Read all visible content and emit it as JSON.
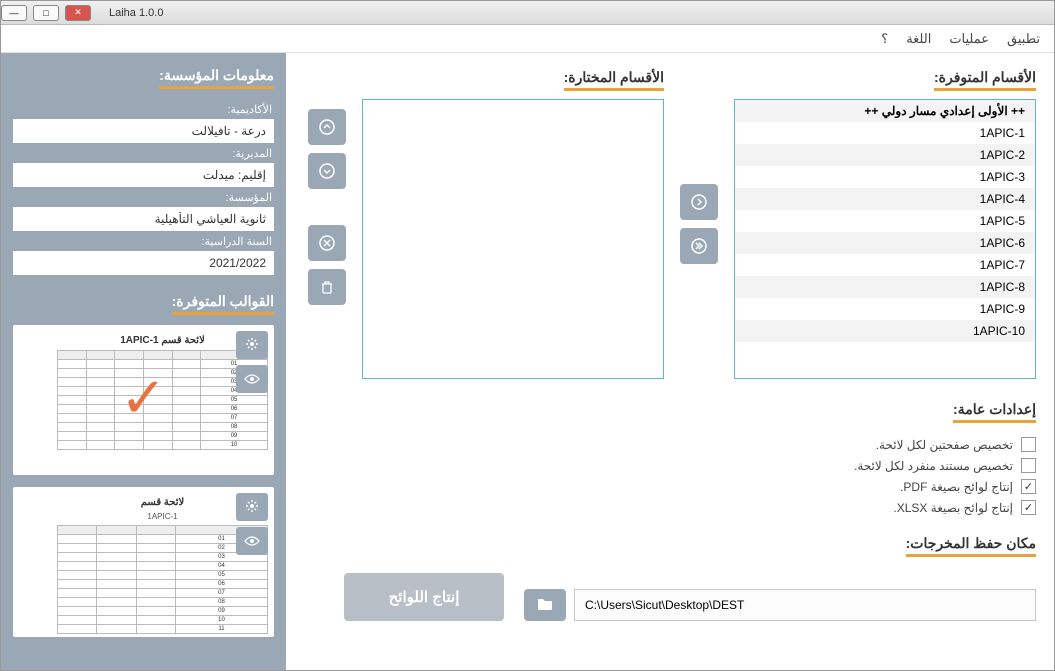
{
  "window": {
    "title": "Laiha 1.0.0"
  },
  "menu": {
    "app": "تطبيق",
    "ops": "عمليات",
    "lang": "اللغة",
    "help": "؟"
  },
  "sections": {
    "available": "الأقسام المتوفرة:",
    "selected": "الأقسام المختارة:",
    "settings": "إعدادات عامة:",
    "output": "مكان حفظ المخرجات:",
    "institution": "معلومات المؤسسة:",
    "templates": "القوالب المتوفرة:"
  },
  "available_items": [
    "++ الأولى إعدادي مسار دولي ++",
    "1APIC-1",
    "1APIC-2",
    "1APIC-3",
    "1APIC-4",
    "1APIC-5",
    "1APIC-6",
    "1APIC-7",
    "1APIC-8",
    "1APIC-9",
    "1APIC-10"
  ],
  "settings_opts": {
    "two_pages": "تخصيص صفحتين لكل لائحة.",
    "sep_doc": "تخصيص مستند منفرد لكل لائحة.",
    "pdf": "إنتاج لوائح بصيغة PDF.",
    "xlsx": "إنتاج لوائح بصيغة XLSX."
  },
  "output_path": "C:\\Users\\Sicut\\Desktop\\DEST",
  "generate_label": "إنتاج اللوائح",
  "institution": {
    "academy_label": "الأكاديمية:",
    "academy": "درعة - تافيلالت",
    "direction_label": "المديرية:",
    "direction": "إقليم: ميدلت",
    "school_label": "المؤسسة:",
    "school": "ثانوية العياشي التأهيلية",
    "year_label": "السنة الدراسية:",
    "year": "2021/2022"
  },
  "template1": {
    "title": "لائحة قسم 1APIC-1"
  },
  "template2": {
    "title": "لائحة قسم",
    "sub": "1APIC-1"
  }
}
